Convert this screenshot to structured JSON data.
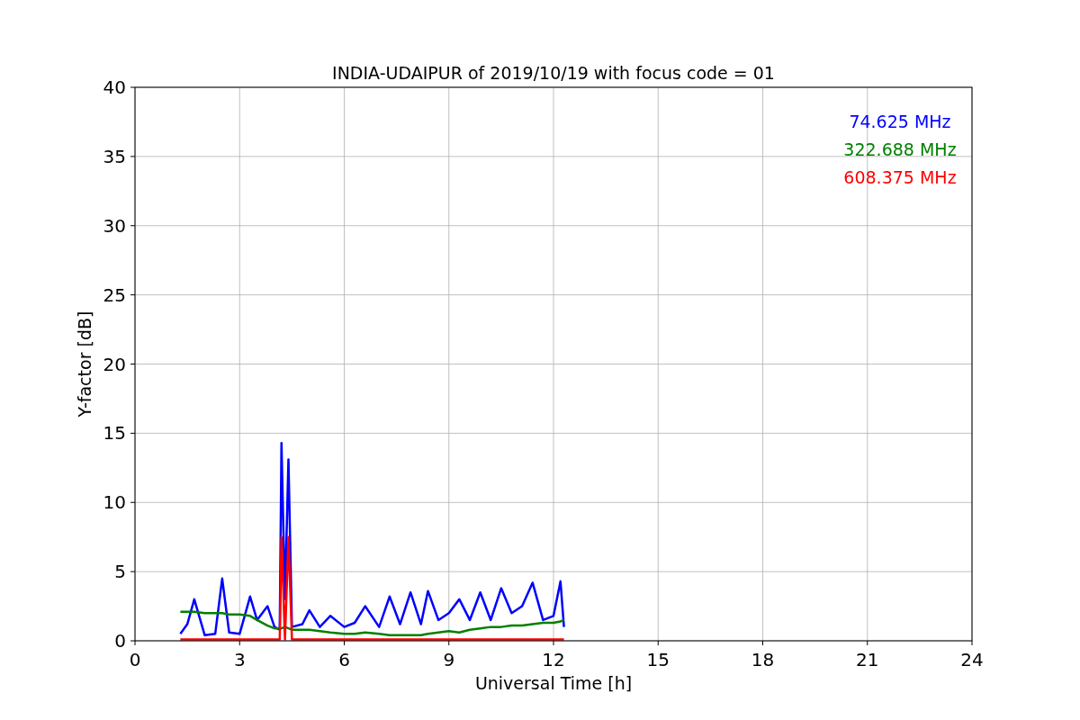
{
  "chart_data": {
    "type": "line",
    "title": "INDIA-UDAIPUR of 2019/10/19 with focus code = 01",
    "xlabel": "Universal Time [h]",
    "ylabel": "Y-factor [dB]",
    "x": [
      1.3,
      1.5,
      1.7,
      2.0,
      2.3,
      2.5,
      2.7,
      3.0,
      3.3,
      3.5,
      3.8,
      4.0,
      4.15,
      4.2,
      4.3,
      4.4,
      4.5,
      4.8,
      5.0,
      5.3,
      5.6,
      6.0,
      6.3,
      6.6,
      7.0,
      7.3,
      7.6,
      7.9,
      8.2,
      8.4,
      8.7,
      9.0,
      9.3,
      9.6,
      9.9,
      10.2,
      10.5,
      10.8,
      11.1,
      11.4,
      11.7,
      12.0,
      12.2,
      12.3
    ],
    "series": [
      {
        "name": "74.625 MHz",
        "color": "#0000ff",
        "values": [
          0.5,
          1.2,
          3.0,
          0.4,
          0.5,
          4.5,
          0.6,
          0.5,
          3.2,
          1.5,
          2.5,
          1.0,
          0.8,
          14.3,
          3.0,
          13.1,
          1.0,
          1.2,
          2.2,
          1.0,
          1.8,
          1.0,
          1.3,
          2.5,
          1.0,
          3.2,
          1.2,
          3.5,
          1.2,
          3.6,
          1.5,
          2.0,
          3.0,
          1.5,
          3.5,
          1.5,
          3.8,
          2.0,
          2.5,
          4.2,
          1.5,
          1.8,
          4.3,
          1.0
        ]
      },
      {
        "name": "322.688 MHz",
        "color": "#008000",
        "values": [
          2.1,
          2.1,
          2.1,
          2.0,
          2.0,
          2.0,
          1.9,
          1.9,
          1.8,
          1.5,
          1.1,
          0.9,
          0.9,
          0.9,
          1.0,
          0.9,
          0.8,
          0.8,
          0.8,
          0.7,
          0.6,
          0.5,
          0.5,
          0.6,
          0.5,
          0.4,
          0.4,
          0.4,
          0.4,
          0.5,
          0.6,
          0.7,
          0.6,
          0.8,
          0.9,
          1.0,
          1.0,
          1.1,
          1.1,
          1.2,
          1.3,
          1.3,
          1.4,
          1.5
        ]
      },
      {
        "name": "608.375 MHz",
        "color": "#ff0000",
        "values": [
          0.1,
          0.1,
          0.1,
          0.1,
          0.1,
          0.1,
          0.1,
          0.1,
          0.1,
          0.1,
          0.1,
          0.1,
          0.1,
          7.5,
          0.1,
          7.5,
          0.1,
          0.1,
          0.1,
          0.1,
          0.1,
          0.1,
          0.1,
          0.1,
          0.1,
          0.1,
          0.1,
          0.1,
          0.1,
          0.1,
          0.1,
          0.1,
          0.1,
          0.1,
          0.1,
          0.1,
          0.1,
          0.1,
          0.1,
          0.1,
          0.1,
          0.1,
          0.1,
          0.1
        ]
      }
    ],
    "xlim": [
      0,
      24
    ],
    "ylim": [
      0,
      40
    ],
    "xticks": [
      0,
      3,
      6,
      9,
      12,
      15,
      18,
      21,
      24
    ],
    "yticks": [
      0,
      5,
      10,
      15,
      20,
      25,
      30,
      35,
      40
    ],
    "grid": true
  }
}
